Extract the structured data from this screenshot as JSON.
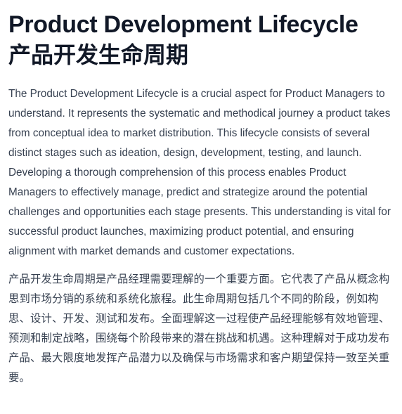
{
  "document": {
    "title_en": "Product Development Lifecycle",
    "title_zh": "产品开发生命周期",
    "paragraph_en": "The Product Development Lifecycle is a crucial aspect for Product Managers to understand. It represents the systematic and methodical journey a product takes from conceptual idea to market distribution. This lifecycle consists of several distinct stages such as ideation, design, development, testing, and launch. Developing a thorough comprehension of this process enables Product Managers to effectively manage, predict and strategize around the potential challenges and opportunities each stage presents. This understanding is vital for successful product launches, maximizing product potential, and ensuring alignment with market demands and customer expectations.",
    "paragraph_zh": "产品开发生命周期是产品经理需要理解的一个重要方面。它代表了产品从概念构思到市场分销的系统和系统化旅程。此生命周期包括几个不同的阶段，例如构思、设计、开发、测试和发布。全面理解这一过程使产品经理能够有效地管理、预测和制定战略，围绕每个阶段带来的潜在挑战和机遇。这种理解对于成功发布产品、最大限度地发挥产品潜力以及确保与市场需求和客户期望保持一致至关重要。"
  }
}
